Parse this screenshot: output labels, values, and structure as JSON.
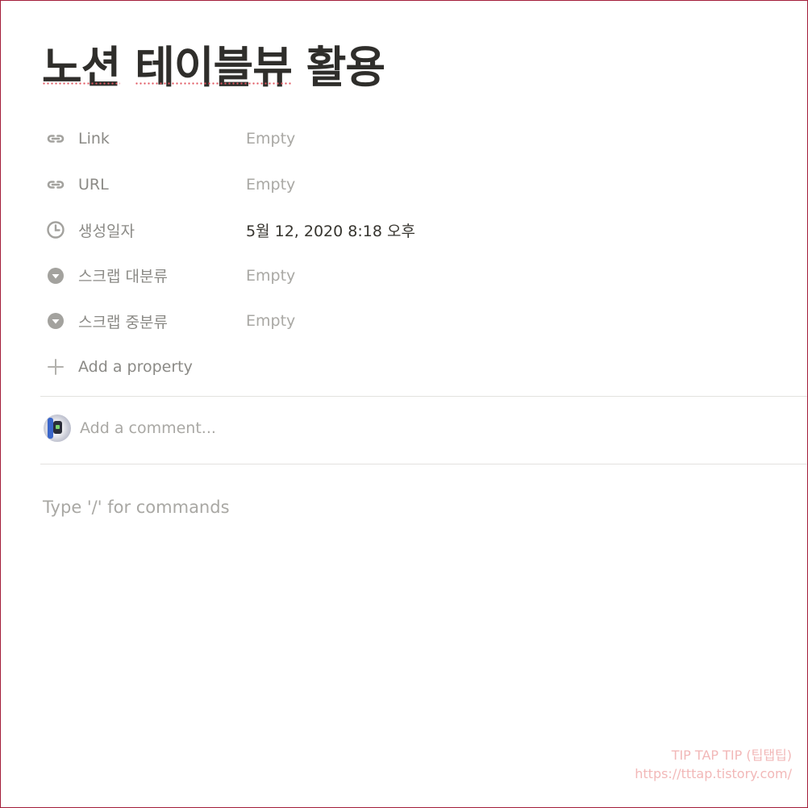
{
  "page": {
    "title_words": [
      "노션",
      "테이블뷰",
      "활용"
    ]
  },
  "properties": [
    {
      "icon": "link-icon",
      "name": "Link",
      "value": "Empty",
      "filled": false
    },
    {
      "icon": "link-icon",
      "name": "URL",
      "value": "Empty",
      "filled": false
    },
    {
      "icon": "clock-icon",
      "name": "생성일자",
      "value": "5월 12, 2020 8:18 오후",
      "filled": true
    },
    {
      "icon": "select-icon",
      "name": "스크랩 대분류",
      "value": "Empty",
      "filled": false
    },
    {
      "icon": "select-icon",
      "name": "스크랩 중분류",
      "value": "Empty",
      "filled": false
    }
  ],
  "add_property": {
    "label": "Add a property",
    "icon": "plus-icon"
  },
  "comment": {
    "placeholder": "Add a comment...",
    "avatar": "avatar"
  },
  "editor": {
    "hint": "Type '/' for commands"
  },
  "watermark": {
    "line1": "TIP TAP TIP (팁탭팁)",
    "line2": "https://tttap.tistory.com/"
  },
  "colors": {
    "frame": "#a31d3a",
    "text": "#37352f",
    "muted": "#a9a8a4",
    "watermark": "#f2b8b8"
  }
}
